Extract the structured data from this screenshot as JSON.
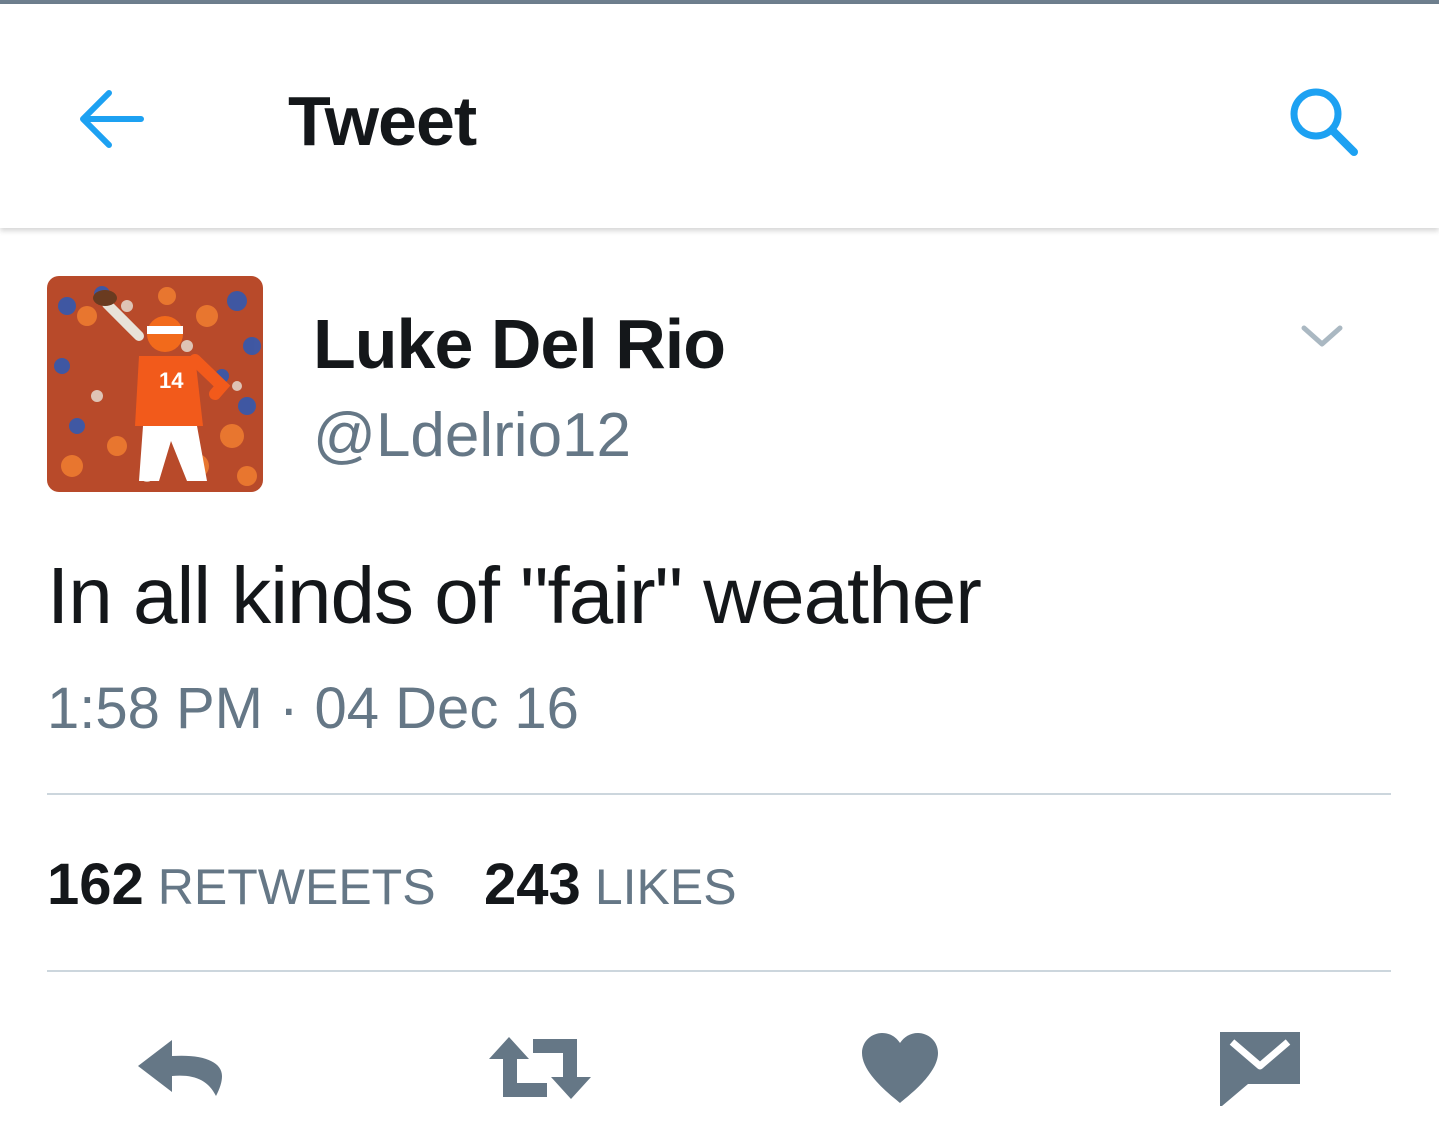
{
  "app_bar": {
    "title": "Tweet",
    "back_icon": "arrow-left-icon",
    "search_icon": "search-icon",
    "accent_color": "#1da1f2"
  },
  "tweet": {
    "author": {
      "display_name": "Luke Del Rio",
      "handle": "@Ldelrio12",
      "avatar": "football-player-photo"
    },
    "text": "In all kinds of \"fair\" weather",
    "timestamp": "1:58 PM · 04 Dec 16",
    "stats": {
      "retweets_count": "162",
      "retweets_label": "RETWEETS",
      "likes_count": "243",
      "likes_label": "LIKES"
    },
    "actions": [
      {
        "name": "reply",
        "icon": "reply-icon"
      },
      {
        "name": "retweet",
        "icon": "retweet-icon"
      },
      {
        "name": "like",
        "icon": "heart-icon"
      },
      {
        "name": "direct-message",
        "icon": "envelope-icon"
      }
    ],
    "icon_color": "#657786",
    "caret_color": "#aab8c2"
  }
}
